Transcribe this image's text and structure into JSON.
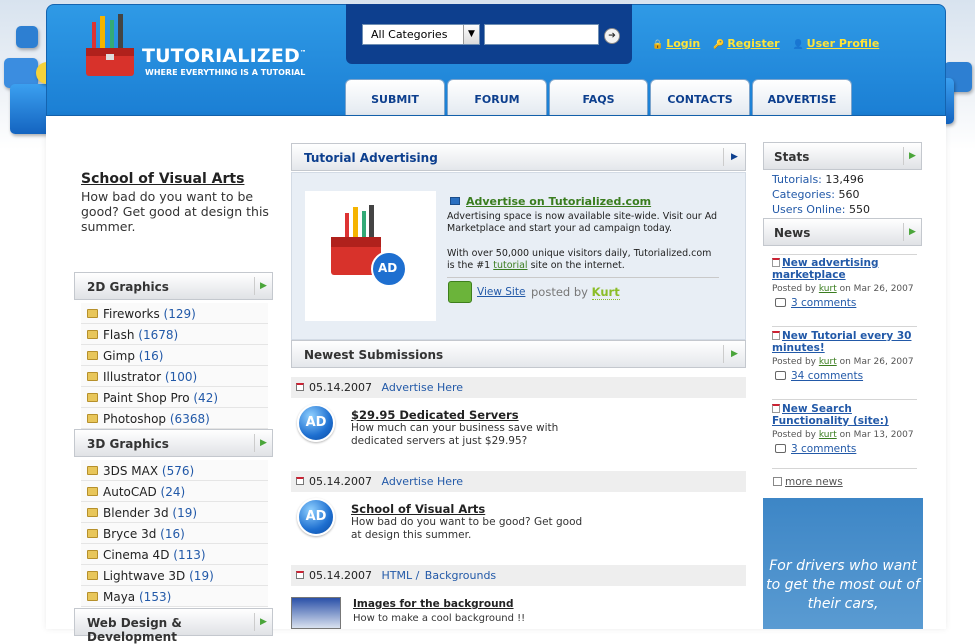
{
  "brand": {
    "name": "TUTORIALIZED",
    "tagline": "WHERE EVERYTHING IS A TUTORIAL",
    "tm": "™"
  },
  "search": {
    "category_selected": "All Categories",
    "query": ""
  },
  "user_links": {
    "login": "Login",
    "register": "Register",
    "profile": "User Profile"
  },
  "nav": [
    "SUBMIT",
    "FORUM",
    "FAQS",
    "CONTACTS",
    "ADVERTISE"
  ],
  "promo": {
    "title": "School of Visual Arts",
    "text": "How bad do you want to be good? Get good at design this summer."
  },
  "sidebar": {
    "sections": [
      {
        "title": "2D Graphics",
        "items": [
          {
            "name": "Fireworks",
            "count": "(129)"
          },
          {
            "name": "Flash",
            "count": "(1678)"
          },
          {
            "name": "Gimp",
            "count": "(16)"
          },
          {
            "name": "Illustrator",
            "count": "(100)"
          },
          {
            "name": "Paint Shop Pro",
            "count": "(42)"
          },
          {
            "name": "Photoshop",
            "count": "(6368)"
          }
        ]
      },
      {
        "title": "3D Graphics",
        "items": [
          {
            "name": "3DS MAX",
            "count": "(576)"
          },
          {
            "name": "AutoCAD",
            "count": "(24)"
          },
          {
            "name": "Blender 3d",
            "count": "(19)"
          },
          {
            "name": "Bryce 3d",
            "count": "(16)"
          },
          {
            "name": "Cinema 4D",
            "count": "(113)"
          },
          {
            "name": "Lightwave 3D",
            "count": "(19)"
          },
          {
            "name": "Maya",
            "count": "(153)"
          }
        ]
      },
      {
        "title": "Web Design & Development",
        "items": []
      }
    ]
  },
  "advertising": {
    "heading": "Tutorial Advertising",
    "badge": "AD",
    "title": "Advertise on Tutorialized.com",
    "desc1": "Advertising space is now available site-wide. Visit our Ad Marketplace and start your ad campaign today.",
    "desc2_pre": "With over 50,000 unique visitors daily, Tutorialized.com is the #1 ",
    "desc2_link": "tutorial",
    "desc2_post": " site on the internet.",
    "view_site": "View Site",
    "posted_by": "posted by",
    "author": "Kurt"
  },
  "newest": {
    "heading": "Newest Submissions",
    "items": [
      {
        "date": "05.14.2007",
        "category": "Advertise Here",
        "subcategory": "",
        "badge": "AD",
        "title": "$29.95 Dedicated Servers",
        "desc": "How much can your business save with dedicated servers at just $29.95?"
      },
      {
        "date": "05.14.2007",
        "category": "Advertise Here",
        "subcategory": "",
        "badge": "AD",
        "title": "School of Visual Arts",
        "desc": "How bad do you want to be good? Get good at design this summer."
      },
      {
        "date": "05.14.2007",
        "category": "HTML /",
        "subcategory": "Backgrounds",
        "badge": "",
        "title": "Images for the background",
        "desc": "How to make a cool background !!"
      }
    ]
  },
  "stats": {
    "heading": "Stats",
    "rows": [
      {
        "label": "Tutorials:",
        "value": "13,496"
      },
      {
        "label": "Categories:",
        "value": "560"
      },
      {
        "label": "Users Online:",
        "value": "550"
      }
    ]
  },
  "news": {
    "heading": "News",
    "items": [
      {
        "title": "New advertising marketplace",
        "posted": "Posted by",
        "author": "kurt",
        "date": "on Mar 26, 2007",
        "comments": "3 comments"
      },
      {
        "title": "New Tutorial every 30 minutes!",
        "posted": "Posted by",
        "author": "kurt",
        "date": "on Mar 26, 2007",
        "comments": "34 comments"
      },
      {
        "title": "New Search Functionality (site:)",
        "posted": "Posted by",
        "author": "kurt",
        "date": "on Mar 13, 2007",
        "comments": "3 comments"
      }
    ],
    "more": "more news"
  },
  "banner": {
    "text": "For drivers who want to get the most out of their cars,"
  },
  "colors": {
    "header_blue": "#1b7fd4",
    "nav_text": "#0d3f8e",
    "link_blue": "#2259a8",
    "user_link_yellow": "#ffe438",
    "green_accent": "#4aa53a"
  }
}
